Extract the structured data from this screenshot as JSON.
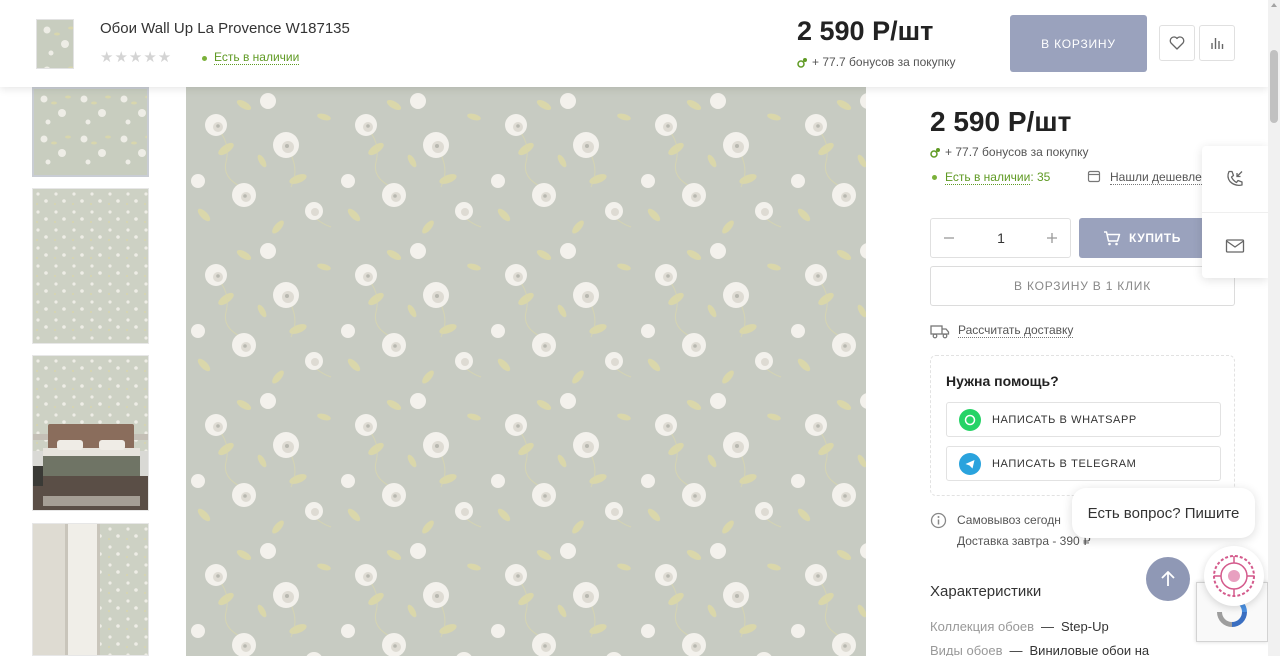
{
  "sticky_header": {
    "title": "Обои Wall Up La Provence W187135",
    "stars": "★★★★★",
    "stock": "Есть в наличии",
    "price": "2 590 Р/шт",
    "bonus": "+ 77.7 бонусов за покупку",
    "cart_button": "В КОРЗИНУ",
    "icons": [
      "heart-icon",
      "compare-icon"
    ]
  },
  "product": {
    "price": "2 590 Р/шт",
    "bonus": "+ 77.7 бонусов за покупку",
    "stock_label": "Есть в наличии",
    "stock_count": ": 35",
    "cheaper_link": "Нашли дешевле",
    "quantity": "1",
    "buy_button": "КУПИТЬ",
    "one_click_button": "В КОРЗИНУ В 1 КЛИК",
    "delivery_link": "Рассчитать доставку"
  },
  "help": {
    "title": "Нужна помощь?",
    "whatsapp": "НАПИСАТЬ В WHATSAPP",
    "telegram": "НАПИСАТЬ В TELEGRAM"
  },
  "delivery_info": {
    "pickup": "Самовывоз сегодн",
    "tomorrow": "Доставка завтра - 390 ₽"
  },
  "characteristics": {
    "title": "Характеристики",
    "rows": [
      {
        "label": "Коллекция обоев",
        "value": "Step-Up"
      },
      {
        "label": "Виды обоев",
        "value": "Виниловые обои на"
      }
    ]
  },
  "widgets": {
    "chat_bubble": "Есть вопрос? Пишите",
    "side_icons": [
      "callback-icon",
      "mail-icon"
    ]
  },
  "colors": {
    "accent": "#9aa2bd",
    "stock_green": "#5f9a23",
    "whatsapp": "#25d366",
    "telegram": "#2aa3dd",
    "wallpaper_bg": "#c7cbc2"
  }
}
